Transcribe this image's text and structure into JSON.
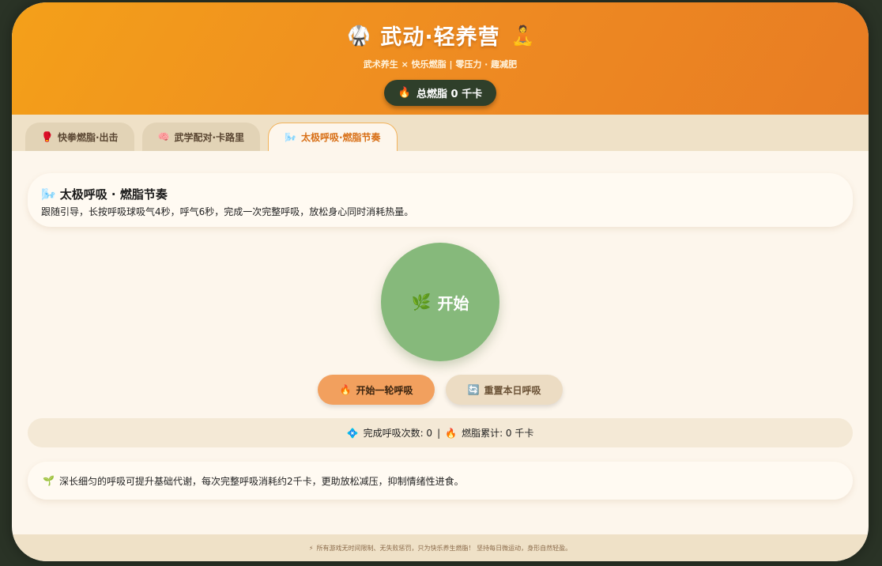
{
  "header": {
    "icon_left": "🥋",
    "title": "武动·轻养营",
    "icon_right": "🧘",
    "subtitle": "武术养生 × 快乐燃脂 | 零压力 · 趣减肥",
    "total_icon": "🔥",
    "total_label": "总燃脂 0 千卡"
  },
  "tabs": [
    {
      "icon": "🥊",
      "label": "快拳燃脂·出击",
      "active": false
    },
    {
      "icon": "🧠",
      "label": "武学配对·卡路里",
      "active": false
    },
    {
      "icon": "🌬️",
      "label": "太极呼吸·燃脂节奏",
      "active": true
    }
  ],
  "panel": {
    "title_icon": "🌬️",
    "title": "太极呼吸 · 燃脂节奏",
    "description": "跟随引导，长按呼吸球吸气4秒，呼气6秒，完成一次完整呼吸，放松身心同时消耗热量。",
    "ball_icon": "🌿",
    "ball_label": "开始",
    "start_button": {
      "icon": "🔥",
      "label": "开始一轮呼吸"
    },
    "reset_button": {
      "icon": "🔄",
      "label": "重置本日呼吸"
    },
    "stats": {
      "count_icon": "💠",
      "count_text": "完成呼吸次数: 0",
      "separator": "|",
      "burn_icon": "🔥",
      "burn_text": "燃脂累计: 0 千卡"
    },
    "tip": {
      "icon": "🌱",
      "text": "深长细匀的呼吸可提升基础代谢，每次完整呼吸消耗约2千卡，更助放松减压，抑制情绪性进食。"
    }
  },
  "footer": {
    "icon": "⚡",
    "text": "所有游戏无时间限制、无失败惩罚，只为快乐养生燃脂！ 坚持每日微运动，身形自然轻盈。"
  },
  "colors": {
    "header_start": "#f4a019",
    "header_end": "#e87c23",
    "breath_ball": "#86b97b",
    "primary_button": "#f2a05e",
    "dark_pill": "#2f3f2a"
  }
}
